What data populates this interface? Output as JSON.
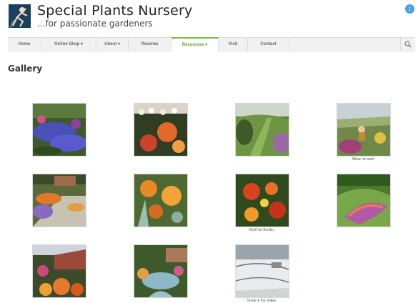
{
  "site": {
    "title": "Special Plants Nursery",
    "tagline": "...for passionate gardeners"
  },
  "nav": {
    "items": [
      {
        "label": "Home"
      },
      {
        "label": "Online Shop"
      },
      {
        "label": "About"
      },
      {
        "label": "Reviews"
      },
      {
        "label": "Resources"
      },
      {
        "label": "Visit"
      },
      {
        "label": "Contact"
      }
    ],
    "active": "Resources"
  },
  "page": {
    "title": "Gallery"
  },
  "gallery": {
    "items": [
      {
        "caption": ""
      },
      {
        "caption": ""
      },
      {
        "caption": ""
      },
      {
        "caption": "Alison at work"
      },
      {
        "caption": ""
      },
      {
        "caption": ""
      },
      {
        "caption": "Red Hot Border"
      },
      {
        "caption": ""
      },
      {
        "caption": ""
      },
      {
        "caption": ""
      },
      {
        "caption": "Snow in the Valley"
      }
    ]
  },
  "icons": {
    "social": "twitter-icon",
    "search": "search-icon",
    "logo": "gardener-logo-icon"
  },
  "colors": {
    "accent": "#7db847",
    "nav_bg": "#f1f1f1",
    "twitter": "#3fa4e0"
  }
}
